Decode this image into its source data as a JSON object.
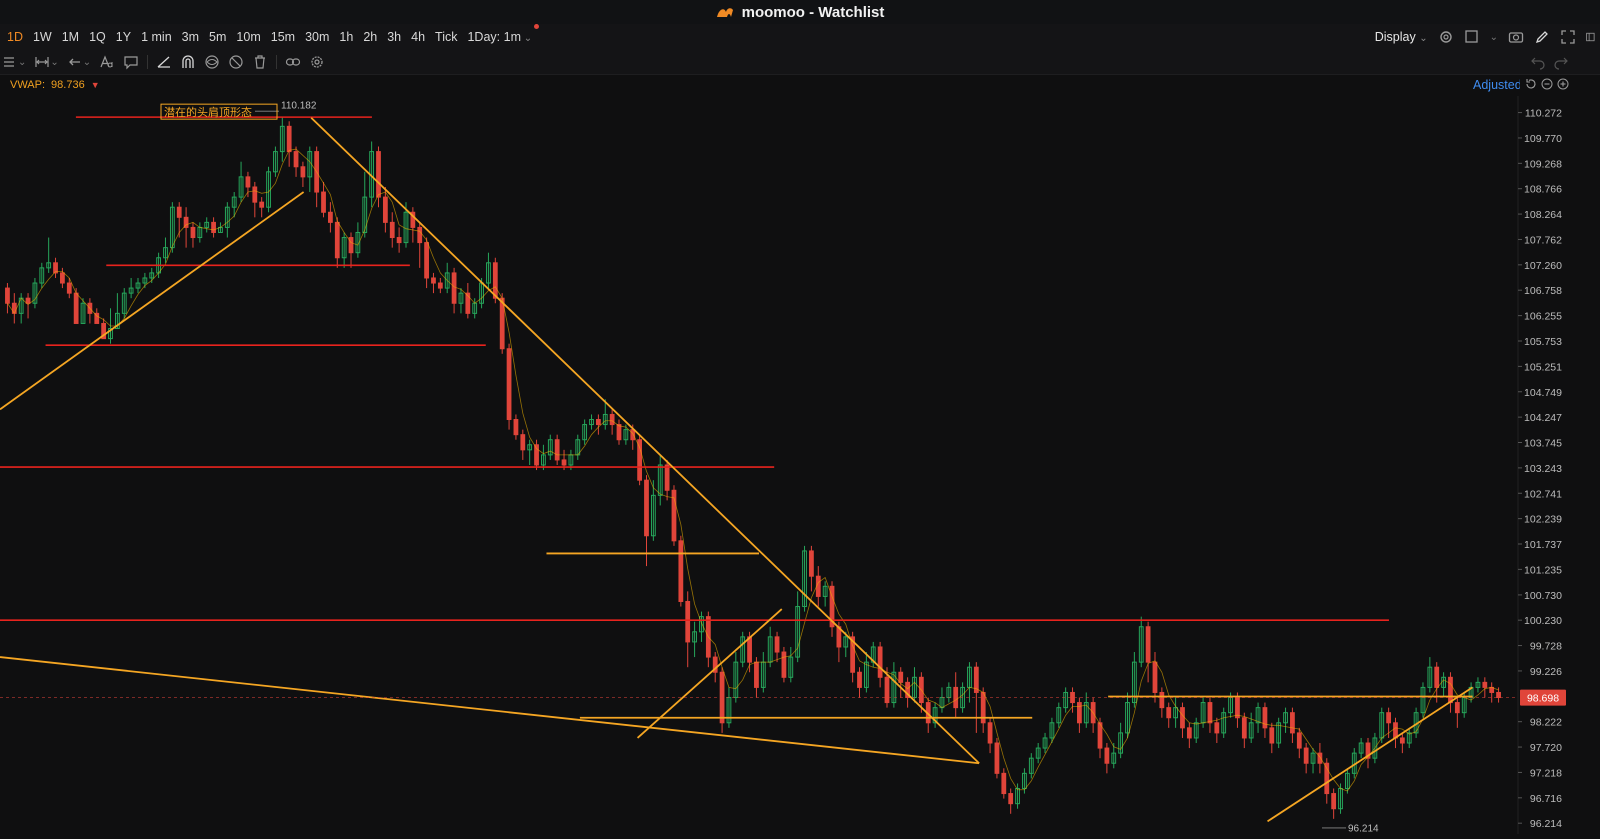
{
  "window": {
    "title": "moomoo - Watchlist",
    "brand_color": "#f08a24"
  },
  "timeframes": {
    "items": [
      "1D",
      "1W",
      "1M",
      "1Q",
      "1Y",
      "1 min",
      "3m",
      "5m",
      "10m",
      "15m",
      "30m",
      "1h",
      "2h",
      "3h",
      "4h",
      "Tick",
      "1Day: 1m"
    ],
    "active": "1D"
  },
  "toolbar": {
    "display_label": "Display",
    "icons": [
      "settings-icon",
      "square-icon",
      "camera-icon",
      "pen-icon",
      "fullscreen-icon",
      "panel-icon"
    ]
  },
  "drawing_tools": [
    "layout-icon",
    "range-icon",
    "undo-arrow-icon",
    "text-icon",
    "comment-icon",
    "line-tool-icon",
    "magnet-icon",
    "eye-icon",
    "hide-icon",
    "trash-icon",
    "link-icon",
    "gear-icon"
  ],
  "indicator": {
    "name": "VWAP:",
    "value": "98.736",
    "adjusted_label": "Adjusted"
  },
  "chart_data": {
    "type": "candlestick",
    "price_axis": {
      "ticks": [
        "110.272",
        "109.770",
        "109.268",
        "108.766",
        "108.264",
        "107.762",
        "107.260",
        "106.758",
        "106.255",
        "105.753",
        "105.251",
        "104.749",
        "104.247",
        "103.745",
        "103.243",
        "102.741",
        "102.239",
        "101.737",
        "101.235",
        "100.730",
        "100.230",
        "99.728",
        "99.226",
        "98.724",
        "98.222",
        "97.720",
        "97.218",
        "96.716",
        "96.214"
      ],
      "ylim": [
        96.0,
        110.6
      ]
    },
    "current_price": "98.698",
    "high_label": "110.182",
    "low_label": "96.214",
    "annotation": "潜在的头肩顶形态",
    "colors": {
      "up": "#26a65b",
      "down": "#e0453a",
      "support": "#e8231d",
      "trend": "#f5a623",
      "vwap": "#f0b400"
    },
    "horizontal_levels": [
      {
        "price": 110.182,
        "x_from": 0.05,
        "x_to": 0.245
      },
      {
        "price": 107.25,
        "x_from": 0.07,
        "x_to": 0.27
      },
      {
        "price": 105.67,
        "x_from": 0.03,
        "x_to": 0.32
      },
      {
        "price": 103.26,
        "x_from": 0.0,
        "x_to": 0.51
      },
      {
        "price": 100.23,
        "x_from": 0.0,
        "x_to": 0.915
      }
    ],
    "trend_lines": [
      {
        "p1": [
          0.0,
          104.4
        ],
        "p2": [
          0.2,
          108.7
        ]
      },
      {
        "p1": [
          0.205,
          110.17
        ],
        "p2": [
          0.645,
          97.4
        ]
      },
      {
        "p1": [
          0.0,
          99.5
        ],
        "p2": [
          0.645,
          97.4
        ]
      },
      {
        "p1": [
          0.382,
          98.3
        ],
        "p2": [
          0.68,
          98.3
        ]
      },
      {
        "p1": [
          0.36,
          101.55
        ],
        "p2": [
          0.5,
          101.55
        ]
      },
      {
        "p1": [
          0.42,
          97.9
        ],
        "p2": [
          0.515,
          100.45
        ]
      },
      {
        "p1": [
          0.73,
          98.72
        ],
        "p2": [
          0.97,
          98.72
        ]
      },
      {
        "p1": [
          0.835,
          96.25
        ],
        "p2": [
          0.97,
          98.9
        ]
      }
    ],
    "candles": [
      [
        106.8,
        106.5,
        106.9,
        106.3
      ],
      [
        106.5,
        106.3,
        106.7,
        106.1
      ],
      [
        106.3,
        106.6,
        106.7,
        106.1
      ],
      [
        106.6,
        106.5,
        106.7,
        106.2
      ],
      [
        106.5,
        106.9,
        107.0,
        106.4
      ],
      [
        106.9,
        107.2,
        107.3,
        106.8
      ],
      [
        107.2,
        107.3,
        107.8,
        107.1
      ],
      [
        107.3,
        107.1,
        107.4,
        107.0
      ],
      [
        107.1,
        106.9,
        107.2,
        106.8
      ],
      [
        106.9,
        106.7,
        107.0,
        106.6
      ],
      [
        106.7,
        106.1,
        106.8,
        106.1
      ],
      [
        106.1,
        106.5,
        106.6,
        106.1
      ],
      [
        106.5,
        106.3,
        106.6,
        106.1
      ],
      [
        106.3,
        106.1,
        106.4,
        106.1
      ],
      [
        106.1,
        105.8,
        106.2,
        105.8
      ],
      [
        105.8,
        106.0,
        106.4,
        105.7
      ],
      [
        106.0,
        106.3,
        106.7,
        106.0
      ],
      [
        106.3,
        106.7,
        106.8,
        106.2
      ],
      [
        106.7,
        106.8,
        107.0,
        106.6
      ],
      [
        106.8,
        106.9,
        107.0,
        106.7
      ],
      [
        106.9,
        107.0,
        107.1,
        106.8
      ],
      [
        107.0,
        107.1,
        107.2,
        106.9
      ],
      [
        107.1,
        107.4,
        107.5,
        107.0
      ],
      [
        107.4,
        107.6,
        107.8,
        107.3
      ],
      [
        107.6,
        108.4,
        108.5,
        107.5
      ],
      [
        108.4,
        108.2,
        108.5,
        107.8
      ],
      [
        108.2,
        108.0,
        108.4,
        107.6
      ],
      [
        108.0,
        107.8,
        108.1,
        107.6
      ],
      [
        107.8,
        108.0,
        108.1,
        107.7
      ],
      [
        108.0,
        108.1,
        108.2,
        107.9
      ],
      [
        108.1,
        107.9,
        108.2,
        107.8
      ],
      [
        107.9,
        108.0,
        108.1,
        107.9
      ],
      [
        108.0,
        108.4,
        108.5,
        107.8
      ],
      [
        108.4,
        108.6,
        108.7,
        108.2
      ],
      [
        108.6,
        109.0,
        109.3,
        108.5
      ],
      [
        109.0,
        108.8,
        109.1,
        108.6
      ],
      [
        108.8,
        108.5,
        108.9,
        108.2
      ],
      [
        108.5,
        108.4,
        108.6,
        108.2
      ],
      [
        108.4,
        109.1,
        109.2,
        108.3
      ],
      [
        109.1,
        109.5,
        109.6,
        109.0
      ],
      [
        109.5,
        110.0,
        110.18,
        109.3
      ],
      [
        110.0,
        109.5,
        110.1,
        109.2
      ],
      [
        109.5,
        109.2,
        109.6,
        109.0
      ],
      [
        109.2,
        109.0,
        109.3,
        108.8
      ],
      [
        109.0,
        109.5,
        109.6,
        108.7
      ],
      [
        109.5,
        108.7,
        109.6,
        108.4
      ],
      [
        108.7,
        108.3,
        108.9,
        108.2
      ],
      [
        108.3,
        108.1,
        108.5,
        107.9
      ],
      [
        108.1,
        107.4,
        108.2,
        107.2
      ],
      [
        107.4,
        107.8,
        107.9,
        107.2
      ],
      [
        107.8,
        107.5,
        107.9,
        107.2
      ],
      [
        107.5,
        107.9,
        108.1,
        107.4
      ],
      [
        107.9,
        108.6,
        109.1,
        107.8
      ],
      [
        108.6,
        109.5,
        109.7,
        108.4
      ],
      [
        109.5,
        108.6,
        109.6,
        108.4
      ],
      [
        108.6,
        108.1,
        108.8,
        107.9
      ],
      [
        108.1,
        107.8,
        108.3,
        107.6
      ],
      [
        107.8,
        107.7,
        108.0,
        107.5
      ],
      [
        107.7,
        108.3,
        108.5,
        107.6
      ],
      [
        108.3,
        108.0,
        108.4,
        107.7
      ],
      [
        108.0,
        107.7,
        108.1,
        107.2
      ],
      [
        107.7,
        107.0,
        107.8,
        106.8
      ],
      [
        107.0,
        106.9,
        107.1,
        106.7
      ],
      [
        106.9,
        106.8,
        107.0,
        106.7
      ],
      [
        106.8,
        107.1,
        107.3,
        106.7
      ],
      [
        107.1,
        106.5,
        107.2,
        106.3
      ],
      [
        106.5,
        106.7,
        106.8,
        106.3
      ],
      [
        106.7,
        106.3,
        106.9,
        106.2
      ],
      [
        106.3,
        106.5,
        106.6,
        106.2
      ],
      [
        106.5,
        106.9,
        107.0,
        106.4
      ],
      [
        106.9,
        107.3,
        107.5,
        106.8
      ],
      [
        107.3,
        106.6,
        107.4,
        106.5
      ],
      [
        106.6,
        105.6,
        106.7,
        105.5
      ],
      [
        105.6,
        104.2,
        105.7,
        104.0
      ],
      [
        104.2,
        103.9,
        104.3,
        103.8
      ],
      [
        103.9,
        103.6,
        104.0,
        103.4
      ],
      [
        103.6,
        103.7,
        103.8,
        103.3
      ],
      [
        103.7,
        103.3,
        103.8,
        103.2
      ],
      [
        103.3,
        103.5,
        103.7,
        103.2
      ],
      [
        103.5,
        103.8,
        103.9,
        103.4
      ],
      [
        103.8,
        103.4,
        103.9,
        103.3
      ],
      [
        103.4,
        103.3,
        103.6,
        103.2
      ],
      [
        103.3,
        103.5,
        103.6,
        103.2
      ],
      [
        103.5,
        103.8,
        103.9,
        103.4
      ],
      [
        103.8,
        104.1,
        104.2,
        103.7
      ],
      [
        104.1,
        104.2,
        104.3,
        104.0
      ],
      [
        104.2,
        104.1,
        104.3,
        103.9
      ],
      [
        104.1,
        104.3,
        104.6,
        104.0
      ],
      [
        104.3,
        104.1,
        104.4,
        103.9
      ],
      [
        104.1,
        103.8,
        104.2,
        103.7
      ],
      [
        103.8,
        104.0,
        104.1,
        103.7
      ],
      [
        104.0,
        103.8,
        104.1,
        103.6
      ],
      [
        103.8,
        103.0,
        103.9,
        102.9
      ],
      [
        103.0,
        101.9,
        103.1,
        101.3
      ],
      [
        101.9,
        102.7,
        103.0,
        101.8
      ],
      [
        102.7,
        103.3,
        103.5,
        102.5
      ],
      [
        103.3,
        102.8,
        103.4,
        102.6
      ],
      [
        102.8,
        101.8,
        102.9,
        101.7
      ],
      [
        101.8,
        100.6,
        101.9,
        100.5
      ],
      [
        100.6,
        99.8,
        100.8,
        99.3
      ],
      [
        99.8,
        100.0,
        100.2,
        99.5
      ],
      [
        100.0,
        100.3,
        100.4,
        99.8
      ],
      [
        100.3,
        99.5,
        100.4,
        99.3
      ],
      [
        99.5,
        99.2,
        99.6,
        99.0
      ],
      [
        99.2,
        98.2,
        99.3,
        98.0
      ],
      [
        98.2,
        98.7,
        98.9,
        98.1
      ],
      [
        98.7,
        99.4,
        99.6,
        98.6
      ],
      [
        99.4,
        99.9,
        100.0,
        99.3
      ],
      [
        99.9,
        99.4,
        100.0,
        99.2
      ],
      [
        99.4,
        98.9,
        99.5,
        98.7
      ],
      [
        98.9,
        99.4,
        99.6,
        98.8
      ],
      [
        99.4,
        99.9,
        100.1,
        99.3
      ],
      [
        99.9,
        99.6,
        100.0,
        99.4
      ],
      [
        99.6,
        99.1,
        99.7,
        99.0
      ],
      [
        99.1,
        99.5,
        99.7,
        99.0
      ],
      [
        99.5,
        100.5,
        100.8,
        99.4
      ],
      [
        100.5,
        101.6,
        101.7,
        100.4
      ],
      [
        101.6,
        101.1,
        101.7,
        100.8
      ],
      [
        101.1,
        100.7,
        101.3,
        100.5
      ],
      [
        100.7,
        100.9,
        101.0,
        100.5
      ],
      [
        100.9,
        100.1,
        101.0,
        99.9
      ],
      [
        100.1,
        99.7,
        100.2,
        99.4
      ],
      [
        99.7,
        99.9,
        100.0,
        99.5
      ],
      [
        99.9,
        99.2,
        100.0,
        99.0
      ],
      [
        99.2,
        98.9,
        99.3,
        98.7
      ],
      [
        98.9,
        99.4,
        99.6,
        98.8
      ],
      [
        99.4,
        99.7,
        99.8,
        99.3
      ],
      [
        99.7,
        99.1,
        99.8,
        98.9
      ],
      [
        99.1,
        98.6,
        99.3,
        98.5
      ],
      [
        98.6,
        99.2,
        99.4,
        98.5
      ],
      [
        99.2,
        99.0,
        99.3,
        98.7
      ],
      [
        99.0,
        98.7,
        99.1,
        98.5
      ],
      [
        98.7,
        99.1,
        99.3,
        98.6
      ],
      [
        99.1,
        98.6,
        99.2,
        98.4
      ],
      [
        98.6,
        98.2,
        98.7,
        98.0
      ],
      [
        98.2,
        98.5,
        98.6,
        98.1
      ],
      [
        98.5,
        98.7,
        98.9,
        98.4
      ],
      [
        98.7,
        98.9,
        99.0,
        98.6
      ],
      [
        98.9,
        98.5,
        99.2,
        98.3
      ],
      [
        98.5,
        98.9,
        99.0,
        98.4
      ],
      [
        98.9,
        99.3,
        99.4,
        98.6
      ],
      [
        99.3,
        98.8,
        99.4,
        98.0
      ],
      [
        98.8,
        98.2,
        98.9,
        98.0
      ],
      [
        98.2,
        97.8,
        98.3,
        97.6
      ],
      [
        97.8,
        97.2,
        97.9,
        97.1
      ],
      [
        97.2,
        96.8,
        97.3,
        96.7
      ],
      [
        96.8,
        96.6,
        96.9,
        96.4
      ],
      [
        96.6,
        96.9,
        97.0,
        96.5
      ],
      [
        96.9,
        97.2,
        97.3,
        96.8
      ],
      [
        97.2,
        97.5,
        97.6,
        97.1
      ],
      [
        97.5,
        97.7,
        97.8,
        97.4
      ],
      [
        97.7,
        97.9,
        98.0,
        97.6
      ],
      [
        97.9,
        98.2,
        98.3,
        97.8
      ],
      [
        98.2,
        98.5,
        98.6,
        98.1
      ],
      [
        98.5,
        98.8,
        98.9,
        98.4
      ],
      [
        98.8,
        98.6,
        98.9,
        98.4
      ],
      [
        98.6,
        98.2,
        98.7,
        98.0
      ],
      [
        98.2,
        98.6,
        98.8,
        98.1
      ],
      [
        98.6,
        98.2,
        98.7,
        98.0
      ],
      [
        98.2,
        97.7,
        98.3,
        97.5
      ],
      [
        97.7,
        97.4,
        97.8,
        97.2
      ],
      [
        97.4,
        97.6,
        97.8,
        97.3
      ],
      [
        97.6,
        98.0,
        98.2,
        97.5
      ],
      [
        98.0,
        98.6,
        98.8,
        97.9
      ],
      [
        98.6,
        99.4,
        99.6,
        98.5
      ],
      [
        99.4,
        100.1,
        100.3,
        99.3
      ],
      [
        100.1,
        99.4,
        100.2,
        99.0
      ],
      [
        99.4,
        98.8,
        99.6,
        98.6
      ],
      [
        98.8,
        98.5,
        98.9,
        98.3
      ],
      [
        98.5,
        98.3,
        98.6,
        98.1
      ],
      [
        98.3,
        98.5,
        98.7,
        98.1
      ],
      [
        98.5,
        98.1,
        98.6,
        97.9
      ],
      [
        98.1,
        97.9,
        98.2,
        97.7
      ],
      [
        97.9,
        98.2,
        98.3,
        97.8
      ],
      [
        98.2,
        98.6,
        98.7,
        98.1
      ],
      [
        98.6,
        98.2,
        98.7,
        98.0
      ],
      [
        98.2,
        98.0,
        98.3,
        97.8
      ],
      [
        98.0,
        98.4,
        98.5,
        97.9
      ],
      [
        98.4,
        98.7,
        98.8,
        98.3
      ],
      [
        98.7,
        98.3,
        98.8,
        98.1
      ],
      [
        98.3,
        97.9,
        98.4,
        97.7
      ],
      [
        97.9,
        98.2,
        98.4,
        97.8
      ],
      [
        98.2,
        98.5,
        98.6,
        98.0
      ],
      [
        98.5,
        98.1,
        98.6,
        97.9
      ],
      [
        98.1,
        97.8,
        98.2,
        97.6
      ],
      [
        97.8,
        98.2,
        98.3,
        97.7
      ],
      [
        98.2,
        98.4,
        98.5,
        98.0
      ],
      [
        98.4,
        98.0,
        98.5,
        97.8
      ],
      [
        98.0,
        97.7,
        98.1,
        97.5
      ],
      [
        97.7,
        97.4,
        97.8,
        97.2
      ],
      [
        97.4,
        97.6,
        97.7,
        97.2
      ],
      [
        97.6,
        97.4,
        97.8,
        97.2
      ],
      [
        97.4,
        96.8,
        97.5,
        96.6
      ],
      [
        96.8,
        96.5,
        96.9,
        96.3
      ],
      [
        96.5,
        96.9,
        97.0,
        96.4
      ],
      [
        96.9,
        97.2,
        97.3,
        96.8
      ],
      [
        97.2,
        97.6,
        97.7,
        97.1
      ],
      [
        97.6,
        97.8,
        97.9,
        97.5
      ],
      [
        97.8,
        97.5,
        97.9,
        97.3
      ],
      [
        97.5,
        97.9,
        98.0,
        97.4
      ],
      [
        97.9,
        98.4,
        98.5,
        97.8
      ],
      [
        98.4,
        98.2,
        98.5,
        97.9
      ],
      [
        98.2,
        97.9,
        98.3,
        97.7
      ],
      [
        97.9,
        97.8,
        98.0,
        97.6
      ],
      [
        97.8,
        98.0,
        98.1,
        97.7
      ],
      [
        98.0,
        98.4,
        98.5,
        97.9
      ],
      [
        98.4,
        98.9,
        99.0,
        98.3
      ],
      [
        98.9,
        99.3,
        99.5,
        98.8
      ],
      [
        99.3,
        98.9,
        99.4,
        98.6
      ],
      [
        98.9,
        99.1,
        99.2,
        98.7
      ],
      [
        99.1,
        98.6,
        99.2,
        98.4
      ],
      [
        98.6,
        98.4,
        98.7,
        98.1
      ],
      [
        98.4,
        98.7,
        98.8,
        98.3
      ],
      [
        98.7,
        98.9,
        99.0,
        98.6
      ],
      [
        98.9,
        99.0,
        99.1,
        98.8
      ],
      [
        99.0,
        98.9,
        99.1,
        98.7
      ],
      [
        98.9,
        98.8,
        99.0,
        98.6
      ],
      [
        98.8,
        98.7,
        98.9,
        98.6
      ]
    ]
  }
}
